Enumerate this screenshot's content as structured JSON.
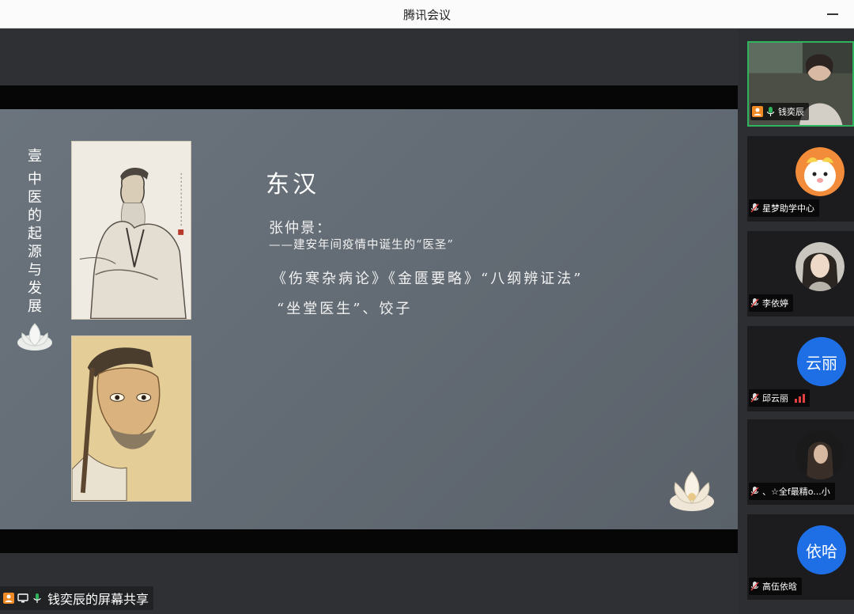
{
  "app": {
    "title": "腾讯会议"
  },
  "slide": {
    "vertical_number": "壹",
    "vertical_title": [
      "中",
      "医",
      "的",
      "起",
      "源",
      "与",
      "发",
      "展"
    ],
    "heading": "东汉",
    "name": "张仲景：",
    "subtitle": "——建安年间疫情中诞生的“医圣”",
    "books": "《伤寒杂病论》《金匮要略》“八纲辨证法”",
    "extra": "“坐堂医生”、饺子"
  },
  "share": {
    "label": "钱奕辰的屏幕共享"
  },
  "participants": [
    {
      "name": "钱奕辰",
      "type": "video",
      "active": true
    },
    {
      "name": "星梦助学中心",
      "type": "avatar-image"
    },
    {
      "name": "李依婷",
      "type": "avatar-image"
    },
    {
      "name": "邱云丽",
      "type": "avatar-text",
      "avatar_text": "云丽",
      "signal": true
    },
    {
      "name": "、☆全f最精o...小",
      "type": "avatar-image"
    },
    {
      "name": "高伍依晗",
      "type": "avatar-text",
      "avatar_text": "依哈"
    }
  ],
  "colors": {
    "accent_active": "#2fb35d",
    "avatar_blue": "#1e6fe6",
    "slide_bg": "#656d76"
  }
}
